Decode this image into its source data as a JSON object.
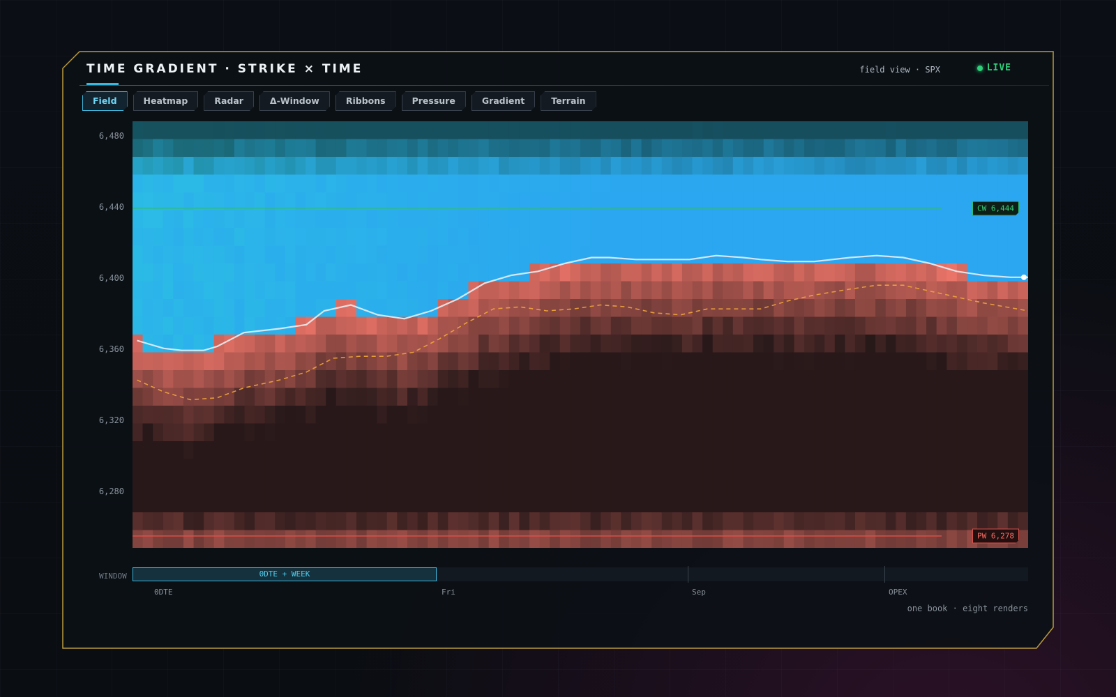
{
  "header": {
    "title": "TIME GRADIENT · STRIKE × TIME",
    "subtitle": "field view · SPX",
    "live_label": "LIVE"
  },
  "tabs": [
    {
      "label": "Field",
      "active": true
    },
    {
      "label": "Heatmap",
      "active": false
    },
    {
      "label": "Radar",
      "active": false
    },
    {
      "label": "Δ-Window",
      "active": false
    },
    {
      "label": "Ribbons",
      "active": false
    },
    {
      "label": "Pressure",
      "active": false
    },
    {
      "label": "Gradient",
      "active": false
    },
    {
      "label": "Terrain",
      "active": false
    }
  ],
  "window": {
    "label": "WINDOW",
    "selection_label": "0DTE + WEEK",
    "ticks": [
      "0DTE",
      "Fri",
      "Sep",
      "OPEX"
    ]
  },
  "footer": "one book · eight renders",
  "colors": {
    "call": "#2ba6f0",
    "call_teal": "#2bc6e0",
    "put": "#f4786c",
    "spot_line": "#e7eef4",
    "flip_line": "#f0a63c",
    "call_wall": "#2fbf68",
    "put_wall": "#d9504a",
    "accent": "#3fb9df",
    "live": "#2fd07a"
  },
  "chart_data": {
    "type": "heatmap",
    "ylim": [
      6272,
      6488
    ],
    "yticks": [
      6480,
      6440,
      6400,
      6360,
      6320,
      6280
    ],
    "ytick_labels": [
      "6,480",
      "6,440",
      "6,400",
      "6,360",
      "6,320",
      "6,280"
    ],
    "xlim": [
      0,
      1
    ],
    "x_ticks": [
      {
        "label": "0DTE",
        "x": 0.02
      },
      {
        "label": "Fri",
        "x": 0.34
      },
      {
        "label": "Sep",
        "x": 0.62
      },
      {
        "label": "OPEX",
        "x": 0.84
      }
    ],
    "call_wall": {
      "label": "CW 6,444",
      "strike": 6444
    },
    "put_wall": {
      "label": "PW 6,278",
      "strike": 6278
    },
    "spot_path": {
      "x": [
        0,
        0.03,
        0.05,
        0.075,
        0.09,
        0.12,
        0.16,
        0.19,
        0.21,
        0.24,
        0.27,
        0.3,
        0.33,
        0.36,
        0.39,
        0.42,
        0.45,
        0.48,
        0.51,
        0.53,
        0.56,
        0.59,
        0.62,
        0.65,
        0.68,
        0.7,
        0.73,
        0.76,
        0.8,
        0.83,
        0.86,
        0.89,
        0.92,
        0.95,
        0.98,
        1
      ],
      "y": [
        6377,
        6373,
        6372,
        6372,
        6374,
        6381,
        6383,
        6385,
        6392,
        6395,
        6390,
        6388,
        6392,
        6398,
        6406,
        6410,
        6412,
        6416,
        6419,
        6419,
        6418,
        6418,
        6418,
        6420,
        6419,
        6418,
        6417,
        6417,
        6419,
        6420,
        6419,
        6416,
        6412,
        6410,
        6409,
        6409
      ]
    },
    "flip_path": {
      "x": [
        0,
        0.03,
        0.06,
        0.09,
        0.12,
        0.16,
        0.19,
        0.22,
        0.25,
        0.28,
        0.31,
        0.34,
        0.37,
        0.4,
        0.43,
        0.46,
        0.49,
        0.52,
        0.55,
        0.58,
        0.61,
        0.64,
        0.67,
        0.7,
        0.73,
        0.76,
        0.8,
        0.83,
        0.86,
        0.89,
        0.92,
        0.95,
        1
      ],
      "y": [
        6357,
        6351,
        6347,
        6348,
        6353,
        6357,
        6361,
        6368,
        6369,
        6369,
        6371,
        6378,
        6386,
        6393,
        6394,
        6392,
        6393,
        6395,
        6394,
        6391,
        6390,
        6393,
        6393,
        6393,
        6397,
        6400,
        6403,
        6405,
        6405,
        6402,
        6399,
        6396,
        6392
      ]
    }
  }
}
